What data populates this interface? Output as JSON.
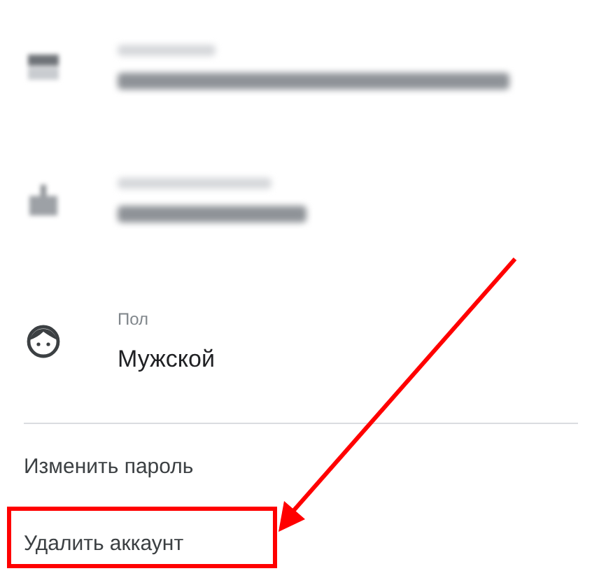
{
  "info_rows": [
    {
      "kind": "email",
      "redacted": true
    },
    {
      "kind": "birthday",
      "redacted": true
    },
    {
      "kind": "gender",
      "redacted": false,
      "label": "Пол",
      "value": "Мужской"
    }
  ],
  "actions": [
    {
      "label": "Изменить пароль"
    },
    {
      "label": "Удалить аккаунт"
    }
  ],
  "annotations": {
    "arrow": true,
    "highlight_box": true
  }
}
